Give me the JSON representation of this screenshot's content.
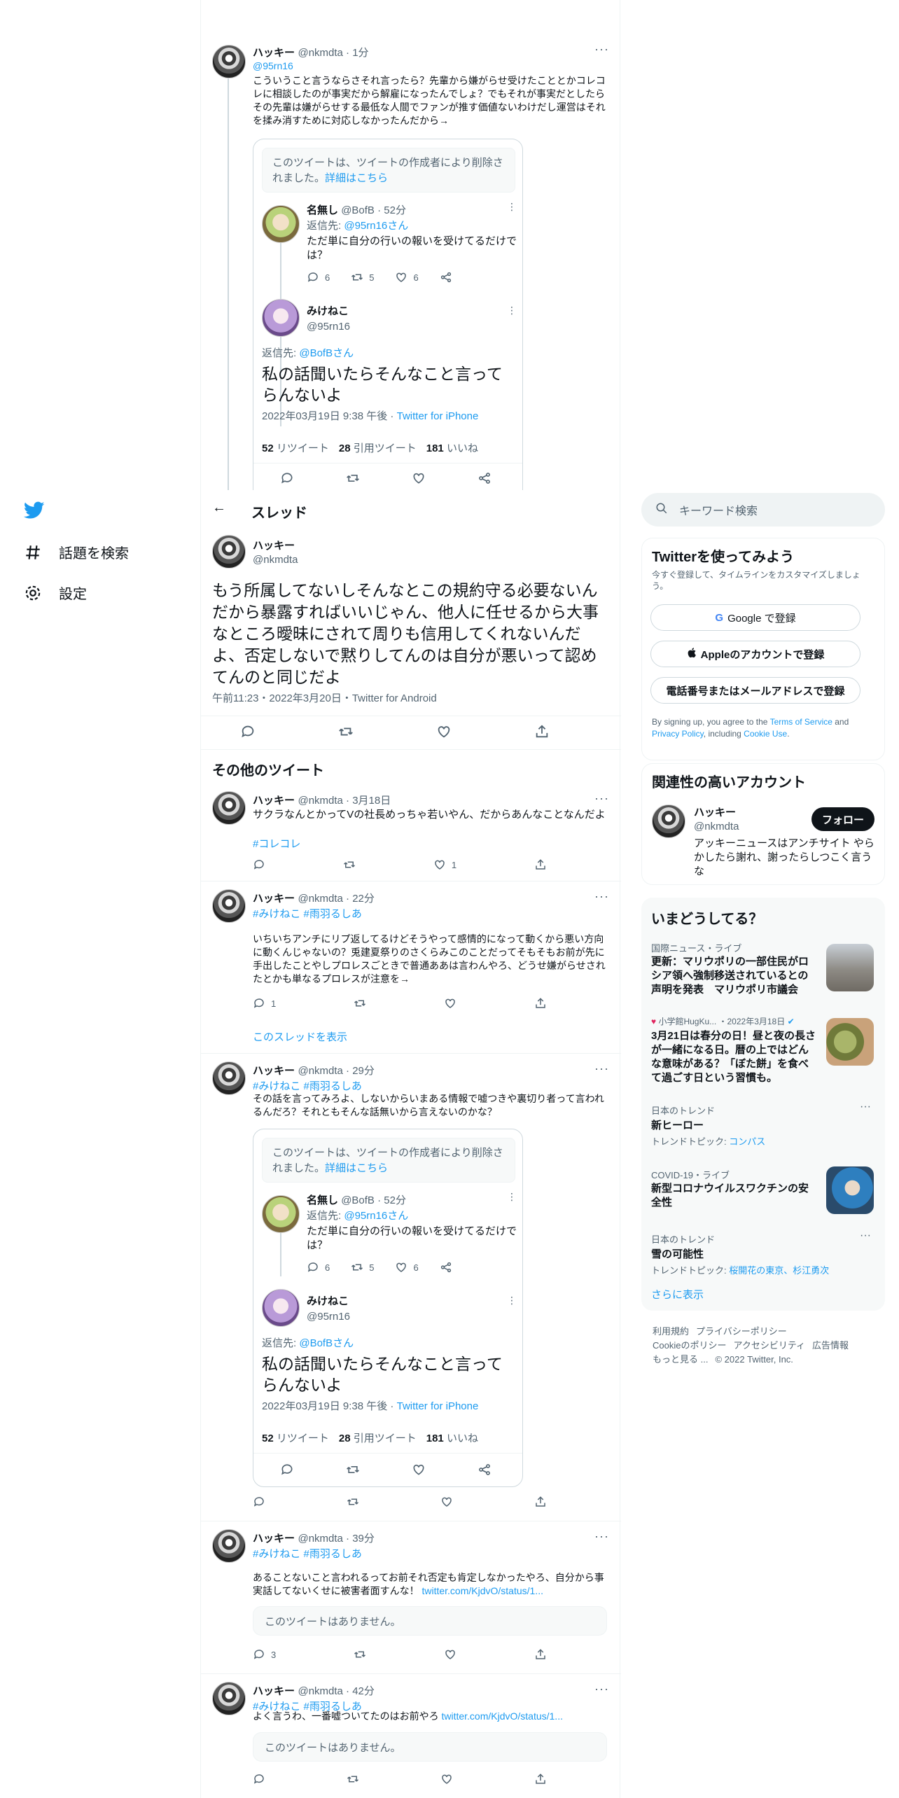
{
  "nav": {
    "explore_label": "話題を検索",
    "settings_label": "設定"
  },
  "top_tweet": {
    "name": "ハッキー",
    "handle_time": "@nkmdta · 1分",
    "reply_to": "@95rn16",
    "text": "こういうこと言うならさそれ言ったら？先輩から嫌がらせ受けたこととかコレコレに相談したのが事実だから解雇になったんでしょ？でもそれが事実だとしたらその先輩は嫌がらせする最低な人間でファンが推す価値ないわけだし運営はそれを揉み消すために対応しなかったんだから→"
  },
  "quote_block": {
    "deleted_text": "このツイートは、ツイートの作成者により削除されました。",
    "deleted_link": "詳細はこちら",
    "reply1": {
      "name": "名無し",
      "handle_time": "@BofB · 52分",
      "reply_to_label": "返信先:",
      "reply_to": "@95rn16さん",
      "text": "ただ単に自分の行いの報いを受けてるだけでは？",
      "replies": "6",
      "retweets": "5",
      "likes": "6"
    },
    "main": {
      "name": "みけねこ",
      "handle": "@95rn16",
      "reply_to_label": "返信先:",
      "reply_to": "@BofBさん",
      "text": "私の話聞いたらそんなこと言ってらんないよ",
      "date": "2022年03月19日 9:38 午後 · ",
      "client": "Twitter for iPhone",
      "rt_count": "52",
      "rt_label": "リツイート",
      "qt_count": "28",
      "qt_label": "引用ツイート",
      "like_count": "181",
      "like_label": "いいね"
    }
  },
  "thread": {
    "header": "スレッド",
    "name": "ハッキー",
    "handle": "@nkmdta",
    "text": "もう所属してないしそんなとこの規約守る必要ないんだから暴露すればいいじゃん、他人に任せるから大事なところ曖昧にされて周りも信用してくれないんだよ、否定しないで黙りしてんのは自分が悪いって認めてんのと同じだよ",
    "meta": "午前11:23・2022年3月20日・Twitter for Android"
  },
  "more_tweets_header": "その他のツイート",
  "tweets": [
    {
      "name": "ハッキー",
      "handle_time": "@nkmdta · 3月18日",
      "text": "サクラなんとかってVの社長めっちゃ若いやん、だからあんなことなんだよ",
      "hashtag": "#コレコレ",
      "likes": "1"
    },
    {
      "name": "ハッキー",
      "handle_time": "@nkmdta · 22分",
      "tags": "#みけねこ #雨羽るしあ",
      "text": "いちいちアンチにリプ返してるけどそうやって感情的になって動くから悪い方向に動くんじゃないの？兎建夏祭りのさくらみこのことだってそもそもお前が先に手出したことやしプロレスごときで普通ああは言わんやろ、どうせ嫌がらせされたとかも単なるプロレスが注意を→",
      "replies": "1",
      "show_thread": "このスレッドを表示"
    },
    {
      "name": "ハッキー",
      "handle_time": "@nkmdta · 29分",
      "tags": "#みけねこ #雨羽るしあ",
      "text": "その話を言ってみろよ、しないからいまある情報で嘘つきや裏切り者って言われるんだろ？それともそんな話無いから言えないのかな？"
    },
    {
      "name": "ハッキー",
      "handle_time": "@nkmdta · 39分",
      "tags": "#みけねこ #雨羽るしあ",
      "text": "あることないこと言われるってお前それ否定も肯定しなかったやろ、自分から事実話してないくせに被害者面すんな！ ",
      "link": "twitter.com/KjdvO/status/1...",
      "unavailable": "このツイートはありません。",
      "replies": "3"
    },
    {
      "name": "ハッキー",
      "handle_time": "@nkmdta · 42分",
      "tags": "#みけねこ #雨羽るしあ",
      "text": "よく言うわ、一番嘘ついてたのはお前やろ ",
      "link": "twitter.com/KjdvO/status/1...",
      "unavailable": "このツイートはありません。"
    }
  ],
  "sidebar": {
    "search_placeholder": "キーワード検索",
    "signup": {
      "title": "Twitterを使ってみよう",
      "subtitle": "今すぐ登録して、タイムラインをカスタマイズしましょう。",
      "google": "Google で登録",
      "apple": "Appleのアカウントで登録",
      "phone": "電話番号またはメールアドレスで登録",
      "legal_1": "By signing up, you agree to the ",
      "terms": "Terms of Service",
      "legal_2": " and ",
      "privacy": "Privacy Policy",
      "legal_3": ", including ",
      "cookie": "Cookie Use",
      "legal_4": "."
    },
    "related": {
      "title": "関連性の高いアカウント",
      "name": "ハッキー",
      "handle": "@nkmdta",
      "follow": "フォロー",
      "bio": "アッキーニュースはアンチサイト やらかしたら謝れ、謝ったらしつこく言うな"
    },
    "trends": {
      "title": "いまどうしてる？",
      "items": [
        {
          "meta": "国際ニュース・ライブ",
          "title": "更新：マリウポリの一部住民がロシア領へ強制移送されているとの声明を発表　マリウポリ市議会"
        },
        {
          "meta": "小学館HugKu... ・2022年3月18日",
          "title": "3月21日は春分の日！昼と夜の長さが一緒になる日。暦の上ではどんな意味がある？「ぼた餅」を食べて過ごす日という習慣も。"
        },
        {
          "meta": "日本のトレンド",
          "title": "新ヒーロー",
          "topic_label": "トレンドトピック: ",
          "topic": "コンパス"
        },
        {
          "meta": "COVID-19・ライブ",
          "title": "新型コロナウイルスワクチンの安全性"
        },
        {
          "meta": "日本のトレンド",
          "title": "雪の可能性",
          "topic_label": "トレンドトピック: ",
          "topic": "桜開花の東京、杉江勇次"
        }
      ],
      "show_more": "さらに表示"
    },
    "footer": {
      "l1": "利用規約",
      "l2": "プライバシーポリシー",
      "l3": "Cookieのポリシー",
      "l4": "アクセシビリティ",
      "l5": "広告情報",
      "l6": "もっと見る ...",
      "copy": "© 2022 Twitter, Inc."
    }
  },
  "colors": {
    "accent": "#1d9bf0",
    "text": "#0f1419",
    "muted": "#536471",
    "border": "#eff3f4"
  }
}
